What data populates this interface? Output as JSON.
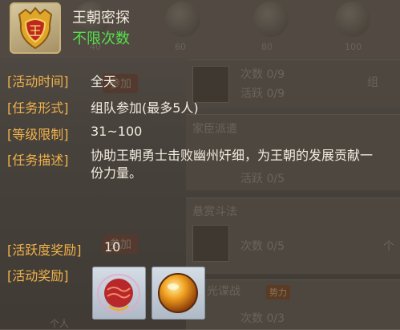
{
  "header": {
    "title": "王朝密探",
    "subtitle": "不限次数"
  },
  "details": {
    "time": {
      "label": "[活动时间]",
      "value": "全天"
    },
    "form": {
      "label": "[任务形式]",
      "value": "组队参加(最多5人)"
    },
    "level": {
      "label": "[等级限制]",
      "value": "31~100"
    },
    "desc": {
      "label": "[任务描述]",
      "value": "协助王朝勇士击败幽州奸细，为王朝的发展贡献一份力量。"
    },
    "activity": {
      "label": "[活跃度奖励]",
      "value": "10"
    },
    "rewards": {
      "label": "[活动奖励]"
    }
  },
  "reward_items": [
    {
      "icon": "red-orb-icon"
    },
    {
      "icon": "golden-orb-icon"
    }
  ],
  "background": {
    "ticks": [
      "40",
      "60",
      "80",
      "100"
    ],
    "entries": [
      {
        "label": "次数",
        "value": "0/9"
      },
      {
        "label": "活跃",
        "value": "0/9"
      },
      {
        "title": "家臣派遣"
      },
      {
        "label": "活跃",
        "value": "0/5"
      },
      {
        "title": "悬赏斗法"
      },
      {
        "label": "次数",
        "value": "0/5"
      },
      {
        "title": "光谍战"
      },
      {
        "label": "次数",
        "value": "0/3"
      }
    ],
    "join_button": "参加",
    "tag": "势力",
    "team_label": "组",
    "people_label": "个",
    "bottom_label": "个人"
  },
  "colors": {
    "label_orange": "#f0b24a",
    "value_white": "#f2ece0",
    "subtitle_green": "#55e04e"
  }
}
